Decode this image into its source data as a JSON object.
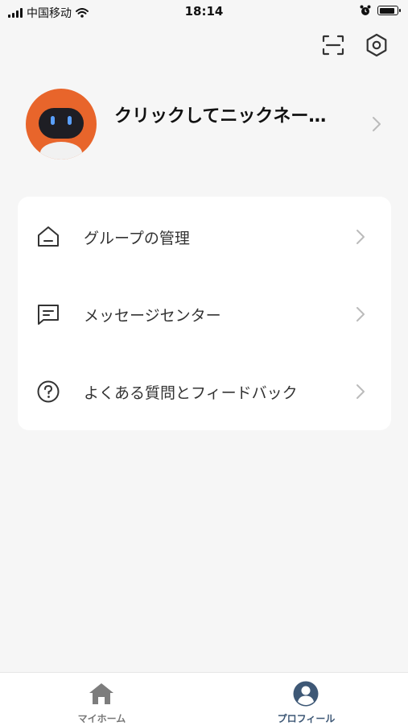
{
  "status_bar": {
    "carrier": "中国移动",
    "time": "18:14",
    "battery_level": 0.8
  },
  "header": {
    "icons": [
      "scan-icon",
      "settings-icon"
    ]
  },
  "profile": {
    "nickname": "クリックしてニックネー…",
    "avatar": "robot-avatar"
  },
  "menu": {
    "items": [
      {
        "label": "グループの管理",
        "icon": "home-icon"
      },
      {
        "label": "メッセージセンター",
        "icon": "message-icon"
      },
      {
        "label": "よくある質問とフィードバック",
        "icon": "help-icon"
      }
    ]
  },
  "tab_bar": {
    "tabs": [
      {
        "label": "マイホーム",
        "icon": "home-icon",
        "active": false
      },
      {
        "label": "プロフィール",
        "icon": "user-icon",
        "active": true
      }
    ],
    "active_color": "#3e5876",
    "inactive_color": "#777777"
  },
  "colors": {
    "background": "#f6f6f6",
    "avatar": "#e8652b"
  }
}
